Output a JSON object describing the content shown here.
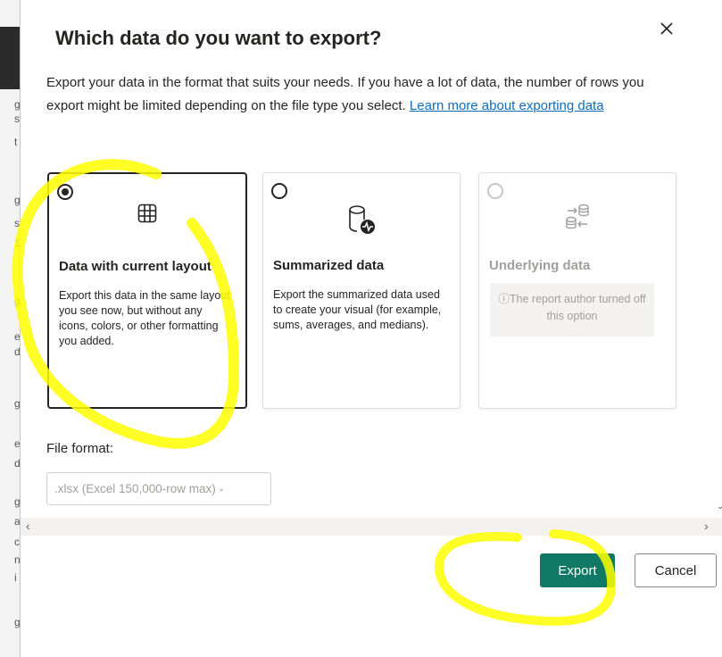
{
  "background_fragments": [
    "g",
    "s",
    "t",
    "g",
    "s",
    "1",
    "g",
    "e",
    "d",
    "g",
    "e",
    "d",
    "g",
    "a",
    "c",
    "n",
    "i",
    "g"
  ],
  "dialog": {
    "title": "Which data do you want to export?",
    "description": "Export your data in the format that suits your needs. If you have a lot of data, the number of rows you export might be limited depending on the file type you select.",
    "learn_more_link": "Learn more about exporting data",
    "close_icon": "close-icon"
  },
  "options": [
    {
      "title": "Data with current layout",
      "description": "Export this data in the same layout you see now, but without any icons, colors, or other formatting you added.",
      "selected": true,
      "icon": "table-grid-icon"
    },
    {
      "title": "Summarized data",
      "description": "Export the summarized data used to create your visual (for example, sums, averages, and medians).",
      "selected": false,
      "icon": "database-activity-icon"
    },
    {
      "title": "Underlying data",
      "note": "The report author turned off this option",
      "note_icon": "info-icon",
      "disabled": true,
      "icon": "database-transfer-icon"
    }
  ],
  "file_format": {
    "label": "File format:",
    "value": ".xlsx (Excel 150,000-row max)"
  },
  "buttons": {
    "export": "Export",
    "cancel": "Cancel"
  },
  "colors": {
    "primary": "#117865",
    "link": "#0f6cbd",
    "highlight": "#ffff00"
  }
}
